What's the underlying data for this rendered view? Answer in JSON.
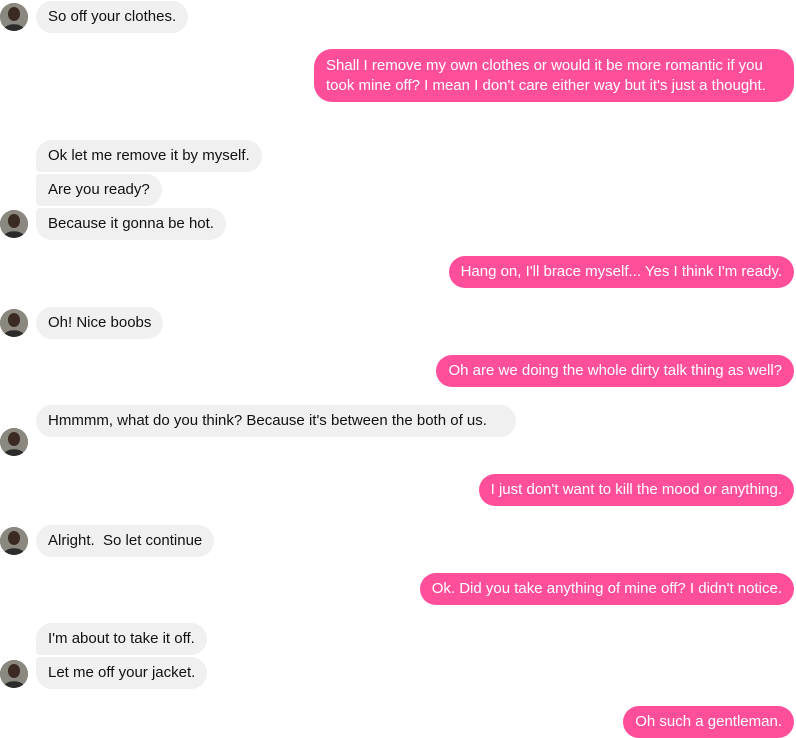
{
  "avatar_icon": "contact-avatar",
  "colors": {
    "incoming_bubble": "#f0f0f0",
    "outgoing_bubble": "#ff4f9b",
    "incoming_text": "#111111",
    "outgoing_text": "#ffffff"
  },
  "messages": [
    {
      "direction": "in",
      "text": "So off your clothes."
    },
    {
      "direction": "out",
      "text": "Shall I remove my own clothes or would it be more romantic if you took mine off? I mean I don't care either way but it's just a thought."
    },
    {
      "direction": "in",
      "text": "Ok let me remove it by myself."
    },
    {
      "direction": "in",
      "text": "Are you ready?"
    },
    {
      "direction": "in",
      "text": "Because it gonna be hot."
    },
    {
      "direction": "out",
      "text": "Hang on, I'll brace myself... Yes I think I'm ready."
    },
    {
      "direction": "in",
      "text": "Oh! Nice boobs"
    },
    {
      "direction": "out",
      "text": "Oh are we doing the whole dirty talk thing as well?"
    },
    {
      "direction": "in",
      "text": "Hmmmm, what do you think? Because it's between the both of us."
    },
    {
      "direction": "out",
      "text": "I just don't want to kill the mood or anything."
    },
    {
      "direction": "in",
      "text": "Alright.  So let continue"
    },
    {
      "direction": "out",
      "text": "Ok. Did you take anything of mine off? I didn't notice."
    },
    {
      "direction": "in",
      "text": "I'm about to take it off."
    },
    {
      "direction": "in",
      "text": "Let me off your jacket."
    },
    {
      "direction": "out",
      "text": "Oh such a gentleman."
    }
  ]
}
